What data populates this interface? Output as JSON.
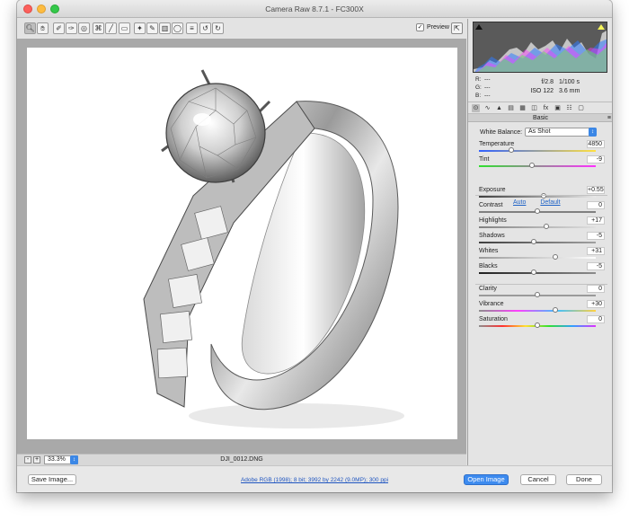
{
  "window": {
    "title": "Camera Raw 8.7.1  -  FC300X"
  },
  "toolbar": {
    "tools": [
      "zoom-tool",
      "hand-tool",
      "white-balance-tool",
      "color-sampler-tool",
      "targeted-adjustment-tool",
      "crop-tool",
      "straighten-tool",
      "spot-removal-tool",
      "red-eye-tool",
      "adjustment-brush-tool",
      "graduated-filter-tool",
      "radial-filter-tool",
      "preferences",
      "rotate-ccw",
      "rotate-cw"
    ],
    "preview_label": "Preview",
    "preview_checked": true
  },
  "status": {
    "zoom": "33.3%",
    "filename": "DJI_0012.DNG"
  },
  "histogram": {
    "rgb_labels": {
      "r": "R:",
      "g": "G:",
      "b": "B:"
    },
    "rgb_values": {
      "r": "---",
      "g": "---",
      "b": "---"
    },
    "aperture": "f/2.8",
    "shutter": "1/100 s",
    "iso": "ISO 122",
    "focal": "3.6 mm"
  },
  "panel": {
    "section_title": "Basic",
    "white_balance_label": "White Balance:",
    "white_balance_value": "As Shot",
    "auto_label": "Auto",
    "default_label": "Default",
    "sliders": [
      {
        "label": "Temperature",
        "value": "4850",
        "fraction": 0.28
      },
      {
        "label": "Tint",
        "value": "-9",
        "fraction": 0.45
      },
      {
        "label": "Exposure",
        "value": "+0.55",
        "fraction": 0.55
      },
      {
        "label": "Contrast",
        "value": "0",
        "fraction": 0.5
      },
      {
        "label": "Highlights",
        "value": "+17",
        "fraction": 0.58
      },
      {
        "label": "Shadows",
        "value": "-5",
        "fraction": 0.47
      },
      {
        "label": "Whites",
        "value": "+31",
        "fraction": 0.65
      },
      {
        "label": "Blacks",
        "value": "-5",
        "fraction": 0.47
      },
      {
        "label": "Clarity",
        "value": "0",
        "fraction": 0.5
      },
      {
        "label": "Vibrance",
        "value": "+30",
        "fraction": 0.65
      },
      {
        "label": "Saturation",
        "value": "0",
        "fraction": 0.5
      }
    ]
  },
  "bottom": {
    "save_label": "Save Image...",
    "info_link": "Adobe RGB (1998); 8 bit; 3992 by 2242 (9.0MP); 300 ppi",
    "open_label": "Open Image",
    "cancel_label": "Cancel",
    "done_label": "Done"
  },
  "colors": {
    "accent": "#3d8bef",
    "link": "#1f55c0"
  }
}
